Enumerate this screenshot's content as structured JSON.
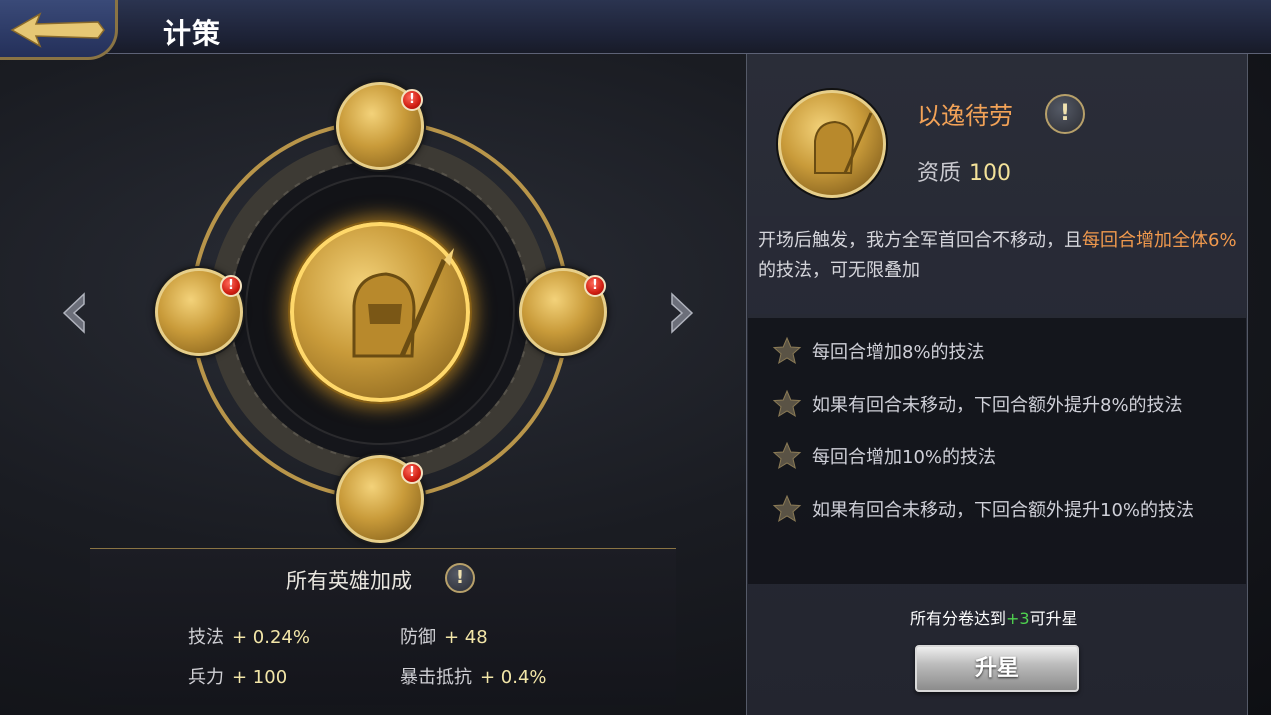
{
  "header": {
    "title": "计策"
  },
  "bonus": {
    "title": "所有英雄加成",
    "info_glyph": "!",
    "stats": [
      {
        "label": "技法",
        "value": "+ 0.24%"
      },
      {
        "label": "防御",
        "value": "+ 48"
      },
      {
        "label": "兵力",
        "value": "+ 100"
      },
      {
        "label": "暴击抵抗",
        "value": "+ 0.4%"
      }
    ]
  },
  "nodes": {
    "badge_glyph": "!",
    "icon": "warrior-portrait-icon"
  },
  "skill": {
    "name": "以逸待劳",
    "info_glyph": "!",
    "quality_label": "资质",
    "quality_value": "100",
    "desc_part1": "开场后触发，我方全军首回合不移动，且",
    "desc_highlight": "每回合增加全体6%",
    "desc_part2": "的技法，可无限叠加"
  },
  "effects": [
    "每回合增加8%的技法",
    "如果有回合未移动，下回合额外提升8%的技法",
    "每回合增加10%的技法",
    "如果有回合未移动，下回合额外提升10%的技法"
  ],
  "upgrade": {
    "req_prefix": "所有分卷达到",
    "req_value": "+3",
    "req_suffix": "可升星",
    "button_label": "升星"
  },
  "colors": {
    "gold": "#e7cf8a",
    "skill_name": "#f2a257",
    "highlight": "#f0994d",
    "green": "#4fd24f"
  }
}
